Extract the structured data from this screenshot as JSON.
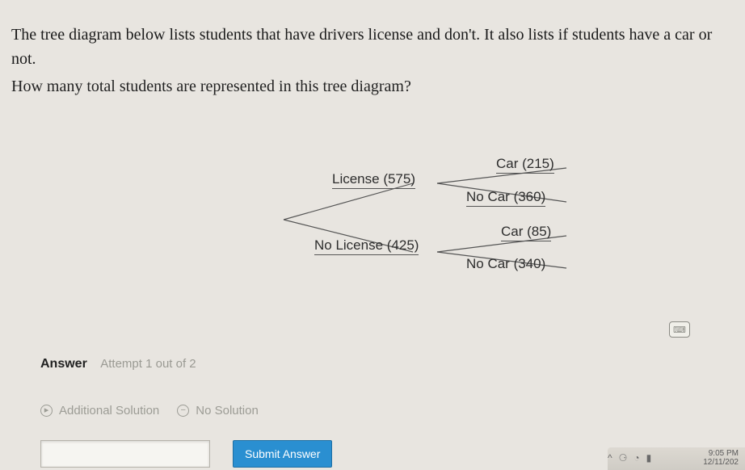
{
  "question": {
    "text": "The tree diagram below lists students that have drivers license and don't. It also lists if students have a car or not.",
    "prompt": "How many total students are represented in this tree diagram?"
  },
  "tree": {
    "branch1": {
      "label": "License (575)",
      "leaf1": "Car (215)",
      "leaf2": "No Car (360)"
    },
    "branch2": {
      "label": "No License (425)",
      "leaf1": "Car (85)",
      "leaf2": "No Car (340)"
    }
  },
  "answer": {
    "heading": "Answer",
    "attempt": "Attempt 1 out of 2"
  },
  "buttons": {
    "additional": "Additional Solution",
    "nosolution": "No Solution",
    "submit": "Submit Answer"
  },
  "input": {
    "value": ""
  },
  "tray": {
    "time": "9:05 PM",
    "date": "12/11/202"
  }
}
